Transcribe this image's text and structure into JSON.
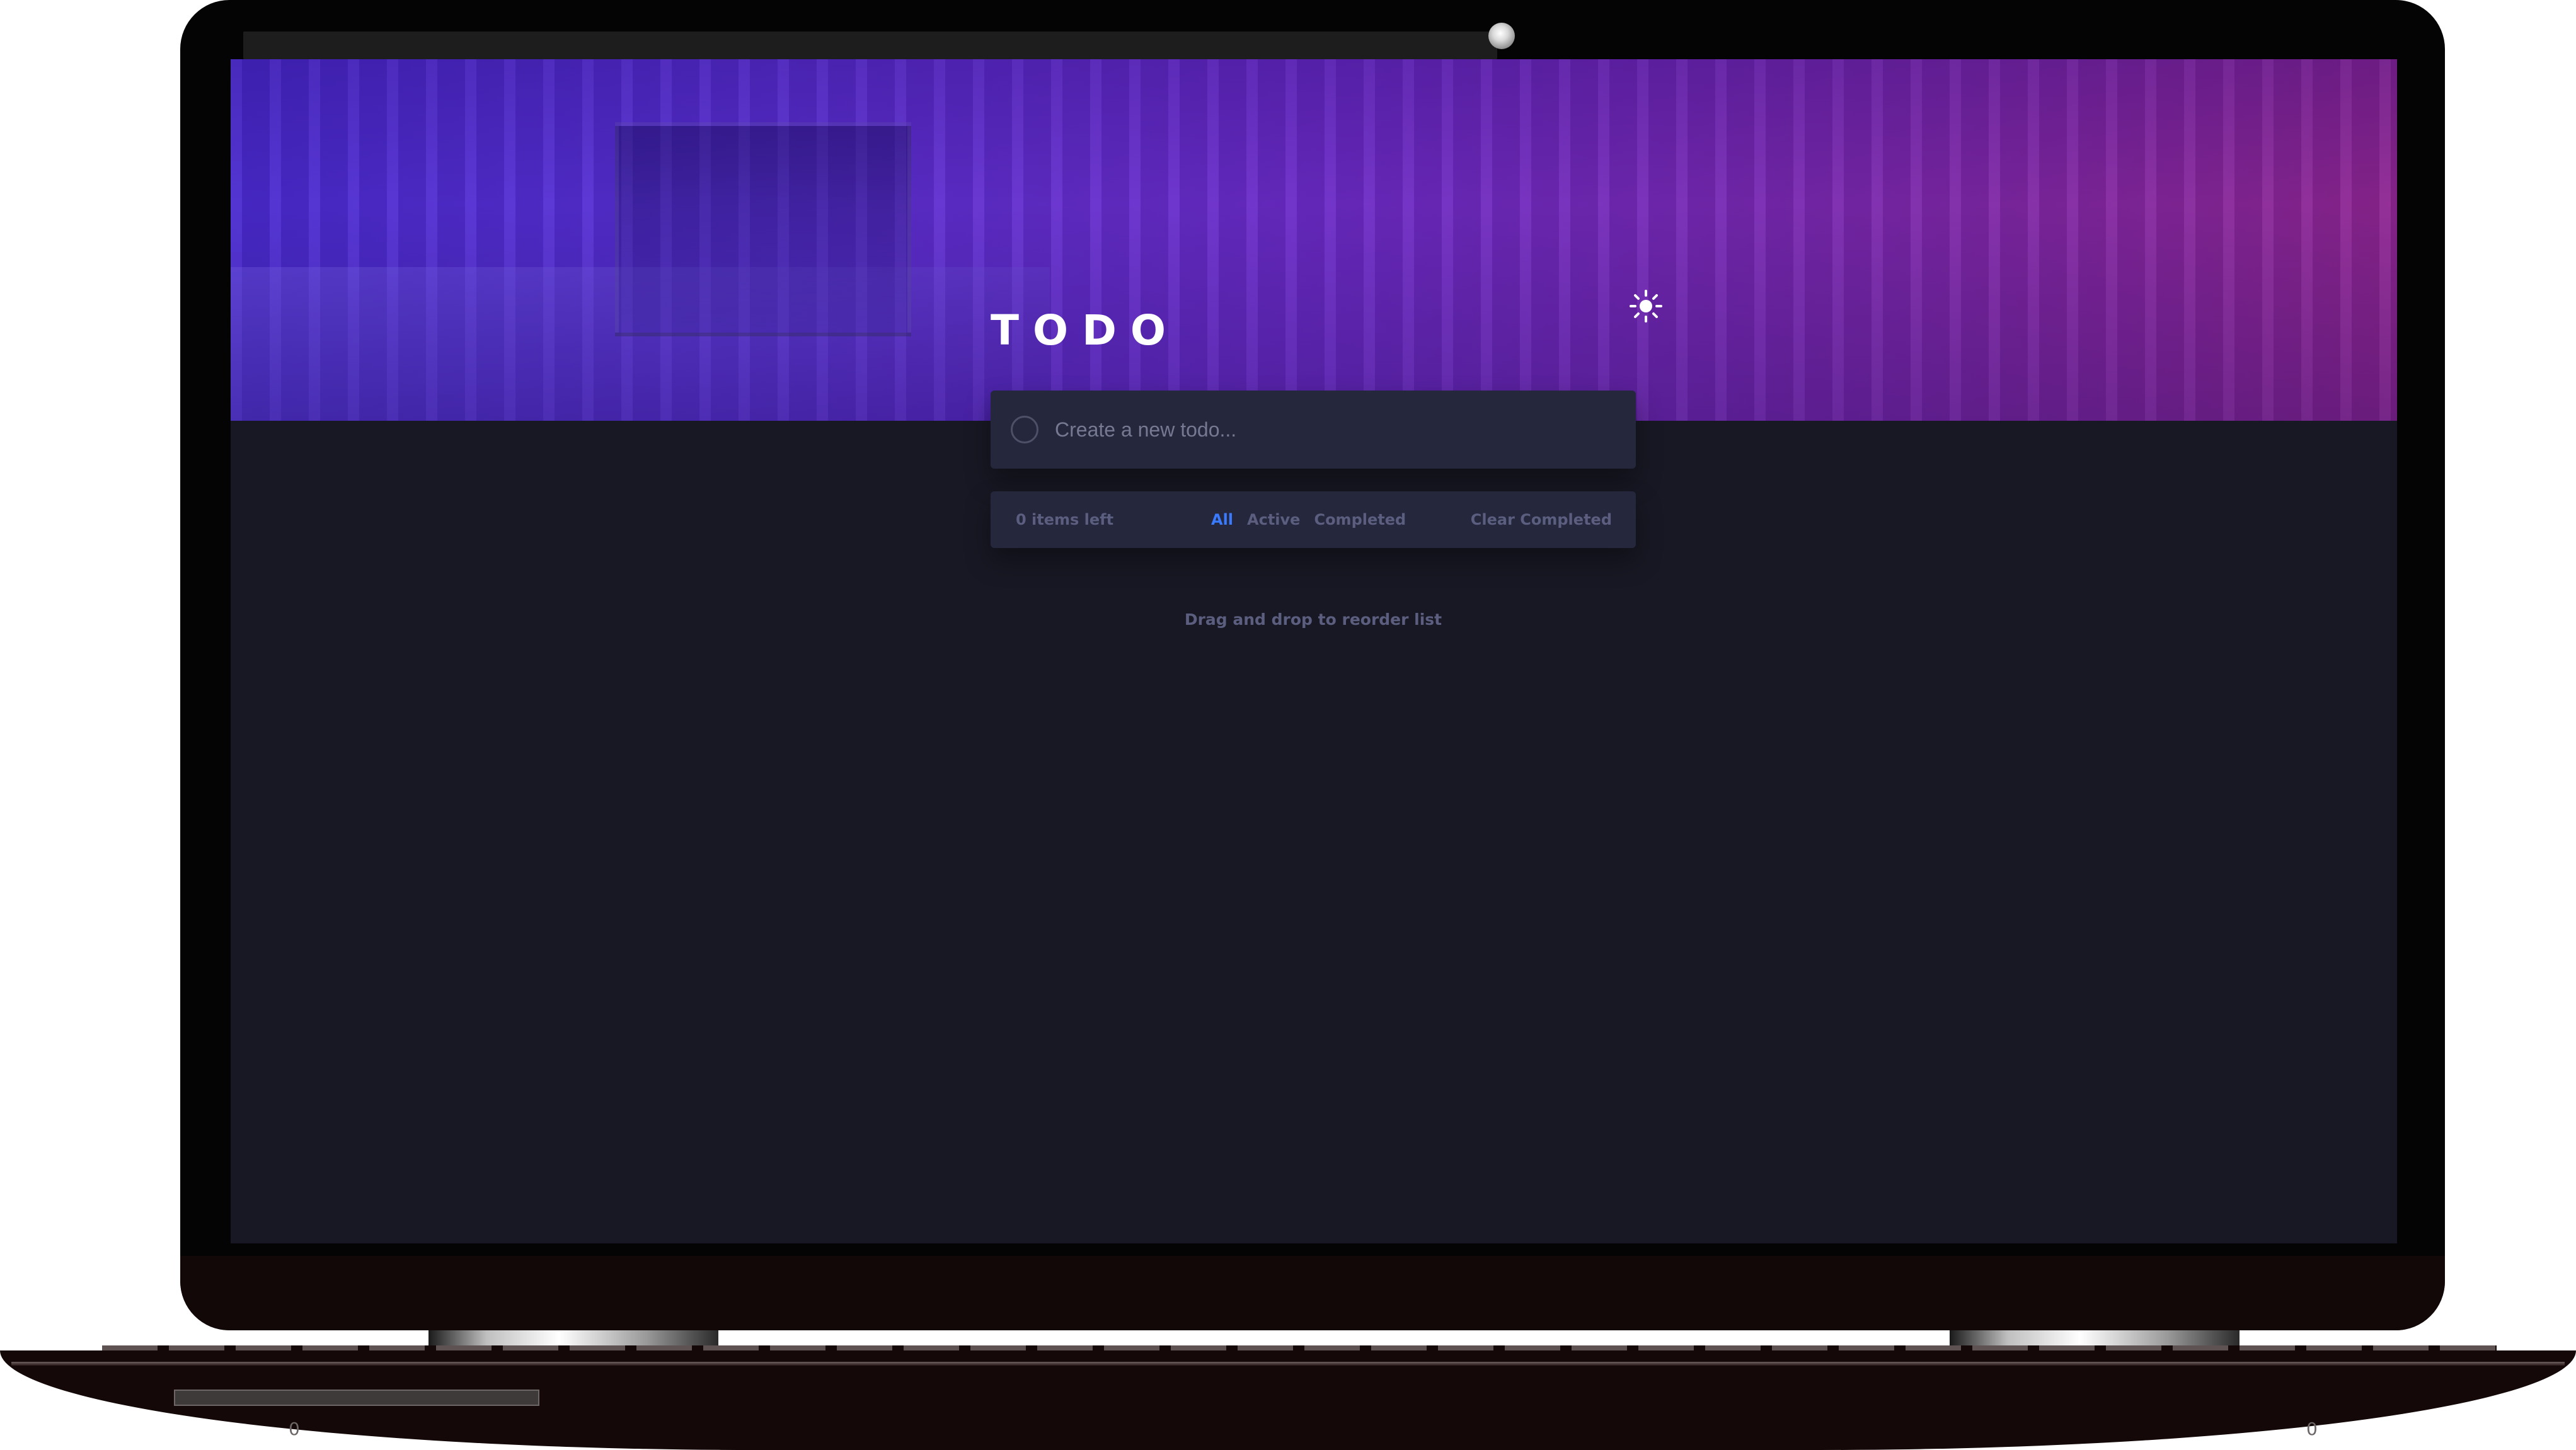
{
  "app": {
    "title": "TODO",
    "theme_toggle_icon": "sun-icon"
  },
  "new_todo": {
    "placeholder": "Create a new todo...",
    "value": ""
  },
  "footer": {
    "items_left": "0 items left",
    "filters": [
      {
        "label": "All",
        "active": true
      },
      {
        "label": "Active",
        "active": false
      },
      {
        "label": "Completed",
        "active": false
      }
    ],
    "clear_completed": "Clear Completed"
  },
  "hint": "Drag and drop to reorder list",
  "device": {
    "base_marks": [
      "0",
      "0"
    ]
  },
  "colors": {
    "background": "#181824",
    "card": "#25273d",
    "accent": "#3a7bfd",
    "muted_text": "#5b5e7e",
    "hero_gradient_start": "#4a2ad0",
    "hero_gradient_end": "#8e2591"
  }
}
